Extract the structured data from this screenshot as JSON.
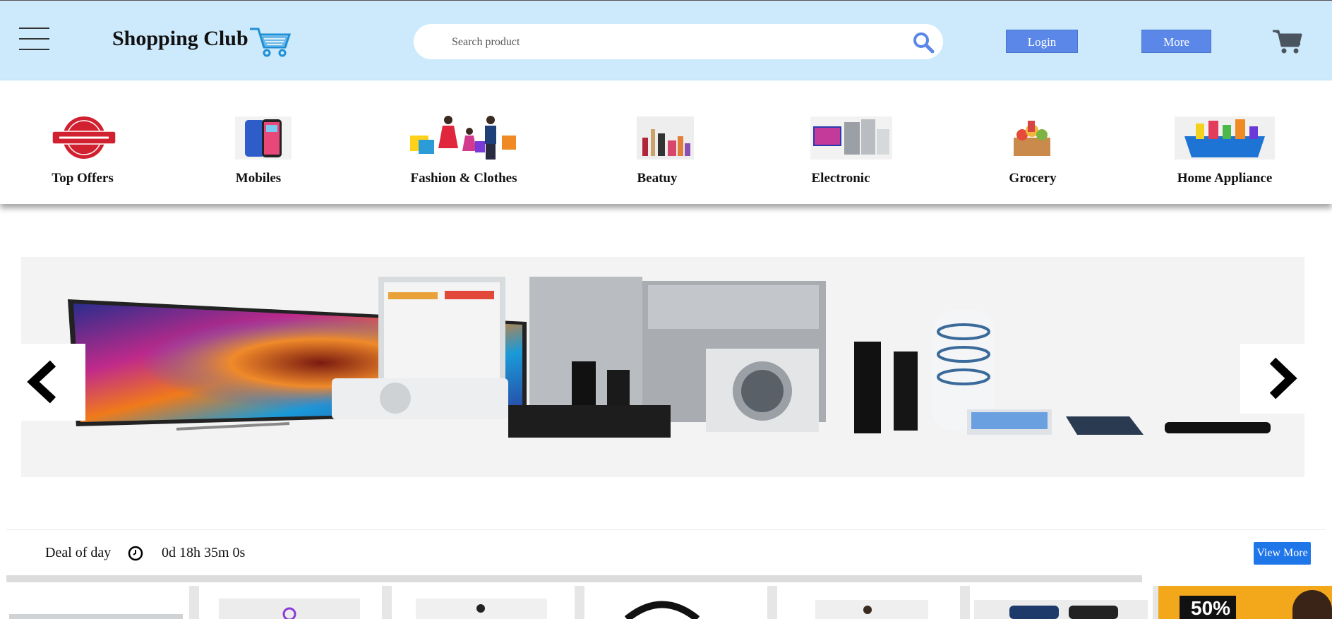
{
  "header": {
    "brand": "Shopping Club",
    "search_placeholder": "Search product",
    "login_label": "Login",
    "more_label": "More",
    "bg_color": "#cdeafc",
    "button_color": "#5b88e8"
  },
  "categories": [
    {
      "label": "Top Offers",
      "icon": "special-offer-badge"
    },
    {
      "label": "Mobiles",
      "icon": "smartphone"
    },
    {
      "label": "Fashion & Clothes",
      "icon": "shoppers-family"
    },
    {
      "label": "Beatuy",
      "icon": "cosmetics"
    },
    {
      "label": "Electronic",
      "icon": "tv-appliances"
    },
    {
      "label": "Grocery",
      "icon": "grocery-box"
    },
    {
      "label": "Home Appliance",
      "icon": "cleaning-basket"
    }
  ],
  "deal": {
    "label": "Deal of day",
    "timer": "0d 18h 35m 0s",
    "view_more_label": "View More",
    "view_more_color": "#1f76e8"
  },
  "banner_text": {
    "sale": "50%"
  }
}
